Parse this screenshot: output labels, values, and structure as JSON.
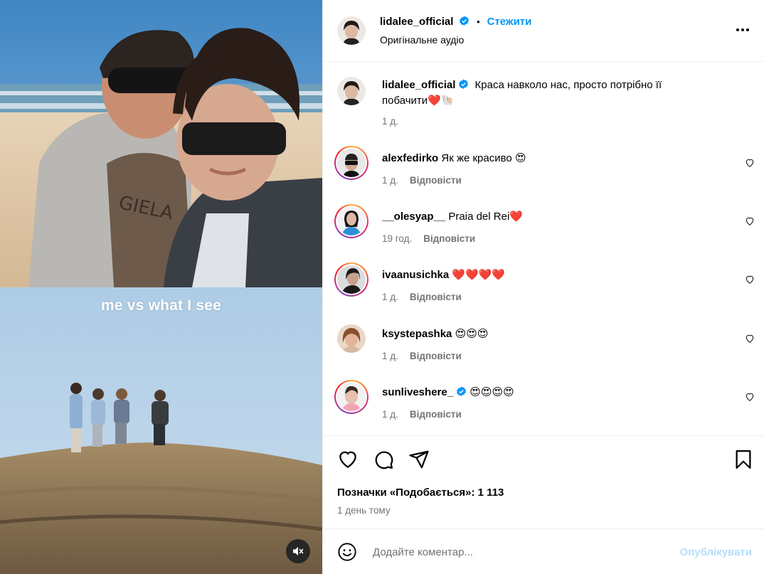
{
  "post": {
    "author": "lidalee_official",
    "follow_label": "Стежити",
    "separator": "•",
    "audio": "Оригінальне аудіо",
    "more_icon": "more-horizontal-icon"
  },
  "media": {
    "overlay_text": "me vs what I see",
    "mute_icon": "speaker-muted-icon"
  },
  "caption": {
    "author": "lidalee_official",
    "text": "Краса навколо нас, просто потрібно її побачити",
    "emojis": "❤️🐚",
    "time": "1 д."
  },
  "comments": [
    {
      "author": "alexfedirko",
      "text": "Як же красиво",
      "emoji": "😍",
      "time": "1 д.",
      "reply": "Відповісти",
      "verified": false,
      "story_ring": true
    },
    {
      "author": "__olesyap__",
      "text": "Praia del Rei",
      "emoji": "❤️",
      "time": "19 год.",
      "reply": "Відповісти",
      "verified": false,
      "story_ring": true
    },
    {
      "author": "ivaanusichka",
      "text": "",
      "emoji": "❤️❤️❤️❤️",
      "time": "1 д.",
      "reply": "Відповісти",
      "verified": false,
      "story_ring": true
    },
    {
      "author": "ksystepashka",
      "text": "",
      "emoji": "😍😍😍",
      "time": "1 д.",
      "reply": "Відповісти",
      "verified": false,
      "story_ring": false
    },
    {
      "author": "sunliveshere_",
      "text": "",
      "emoji": "😍😍😍😍",
      "time": "1 д.",
      "reply": "Відповісти",
      "verified": true,
      "story_ring": true
    }
  ],
  "actions": {
    "like_icon": "heart-icon",
    "comment_icon": "comment-bubble-icon",
    "share_icon": "paper-plane-icon",
    "save_icon": "bookmark-icon"
  },
  "likes_label": "Позначки «Подобається»: 1 113",
  "posted": "1 день тому",
  "composer": {
    "placeholder": "Додайте коментар...",
    "publish": "Опублікувати",
    "emoji_icon": "smiley-icon"
  },
  "colors": {
    "link_blue": "#0095f6",
    "publish_disabled": "#b2dffc",
    "muted_text": "#737373",
    "divider": "#efefef",
    "heart_red": "#ff3040"
  }
}
